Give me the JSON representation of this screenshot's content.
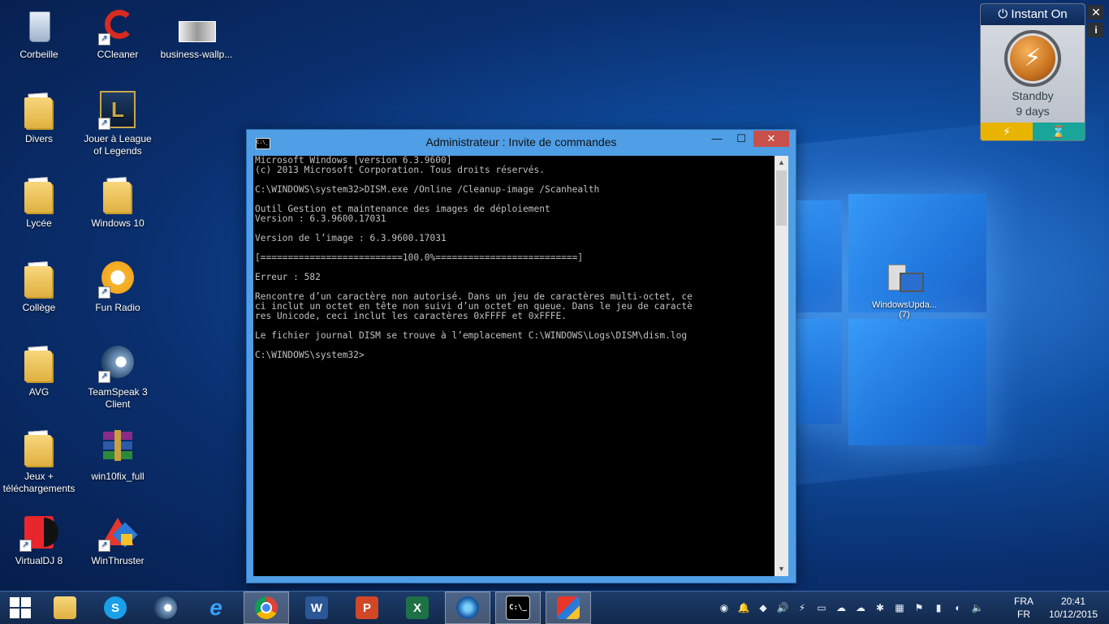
{
  "desktop": {
    "icons": [
      {
        "label": "Corbeille"
      },
      {
        "label": "CCleaner"
      },
      {
        "label": "business-wallp..."
      },
      {
        "label": "Divers"
      },
      {
        "label": "Jouer à League of Legends"
      },
      {
        "label": "Lycée"
      },
      {
        "label": "Windows 10"
      },
      {
        "label": "Collège"
      },
      {
        "label": "Fun Radio"
      },
      {
        "label": "AVG"
      },
      {
        "label": "TeamSpeak 3 Client"
      },
      {
        "label": "Jeux + téléchargements"
      },
      {
        "label": "win10fix_full"
      },
      {
        "label": "VirtualDJ 8"
      },
      {
        "label": "WinThruster"
      }
    ],
    "windows_update_file": {
      "label": "WindowsUpda...",
      "count": "(7)"
    }
  },
  "gadget": {
    "title": "Instant On",
    "state": "Standby",
    "duration": "9 days",
    "close_symbol": "✕",
    "info_symbol": "i",
    "colors": {
      "left_bar": "#e8b400",
      "right_bar": "#1aa59a"
    }
  },
  "console": {
    "title": "Administrateur : Invite de commandes",
    "icon_text": "C:\\_",
    "minimize_symbol": "—",
    "maximize_symbol": "☐",
    "close_symbol": "✕",
    "lines": [
      "Microsoft Windows [version 6.3.9600]",
      "(c) 2013 Microsoft Corporation. Tous droits réservés.",
      "",
      "C:\\WINDOWS\\system32>DISM.exe /Online /Cleanup-image /Scanhealth",
      "",
      "Outil Gestion et maintenance des images de déploiement",
      "Version : 6.3.9600.17031",
      "",
      "Version de l’image : 6.3.9600.17031",
      "",
      "[==========================100.0%==========================]",
      "",
      "Erreur : 582",
      "",
      "Rencontre d’un caractère non autorisé. Dans un jeu de caractères multi-octet, ce",
      "ci inclut un octet en tête non suivi d’un octet en queue. Dans le jeu de caractè",
      "res Unicode, ceci inclut les caractères 0xFFFF et 0xFFFE.",
      "",
      "Le fichier journal DISM se trouve à l’emplacement C:\\WINDOWS\\Logs\\DISM\\dism.log",
      "",
      "C:\\WINDOWS\\system32>"
    ]
  },
  "taskbar": {
    "start_icon": "windows-start-icon",
    "items": [
      "file-explorer-icon",
      "skype-icon",
      "teamspeak-icon",
      "internet-explorer-icon",
      "chrome-icon",
      "word-icon",
      "powerpoint-icon",
      "excel-icon",
      "avg-icon",
      "cmd-icon",
      "winthruster-icon"
    ],
    "glyphs": {
      "skype": "S",
      "word": "W",
      "powerpoint": "P",
      "excel": "X",
      "cmd": "C:\\_",
      "ie": "e"
    },
    "tray_glyphs": [
      "◉",
      "🔔",
      "◆",
      "🔊",
      "⚡",
      "▭",
      "☁",
      "☁",
      "✱",
      "▦",
      "⚑",
      "▮",
      "◐",
      "🔈"
    ],
    "language_primary": "FRA",
    "language_secondary": "FR",
    "time": "20:41",
    "date": "10/12/2015"
  }
}
